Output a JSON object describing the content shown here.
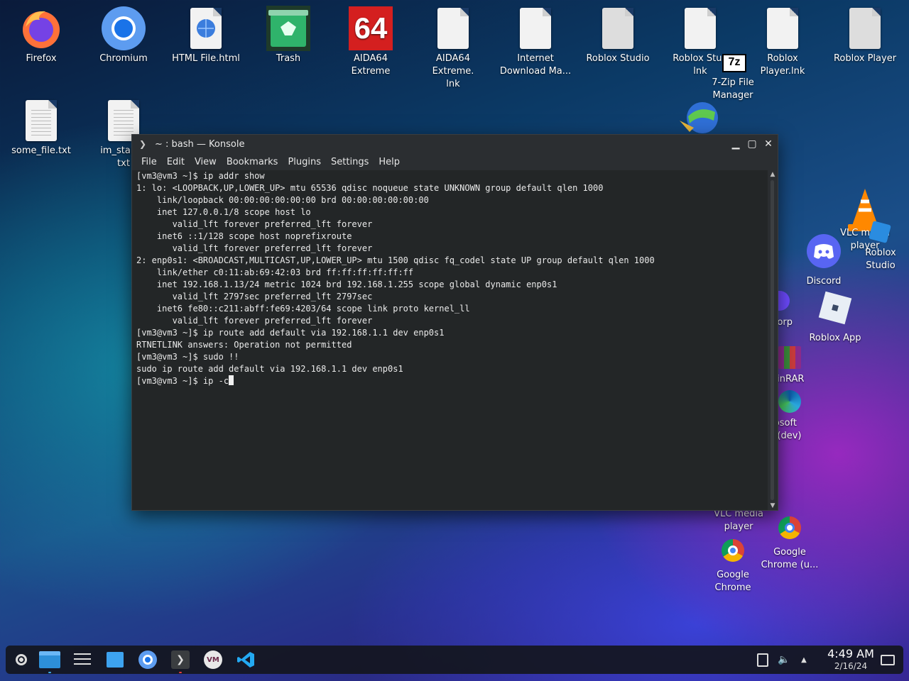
{
  "desktop": {
    "icons": {
      "firefox": "Firefox",
      "chromium": "Chromium",
      "html_file": "HTML File.html",
      "trash": "Trash",
      "aida64": "AIDA64 Extreme",
      "aida64_lnk": "AIDA64 Extreme.\nlnk",
      "idm": "Internet\nDownload Ma...",
      "roblox_studio": "Roblox Studio",
      "roblox_studio_lnk": "Roblox Stud\nlnk",
      "roblox_player_lnk": "Roblox Player.lnk",
      "roblox_player": "Roblox Player",
      "sevenzip": "7-Zip File\nManager",
      "some_file": "some_file.txt",
      "im_stalkin": "im_stalkin\ntxt",
      "vlc_top": "VLC media\nplayer",
      "roblox_studio_right": "Roblox\nStudio",
      "discord": "Discord",
      "orp": "orp",
      "roblox_app": "Roblox App",
      "winrar": "VinRAR",
      "edge_dev": "icrosoft\nge (dev)",
      "vlc_bottom": "VLC media\nplayer",
      "chrome_unstable": "Google\nChrome (u...",
      "chrome": "Google\nChrome"
    },
    "aida_badge": "64",
    "sevenzip_badge": "7z"
  },
  "konsole": {
    "title": "~ : bash — Konsole",
    "menu": [
      "File",
      "Edit",
      "View",
      "Bookmarks",
      "Plugins",
      "Settings",
      "Help"
    ],
    "lines": [
      "[vm3@vm3 ~]$ ip addr show",
      "1: lo: <LOOPBACK,UP,LOWER_UP> mtu 65536 qdisc noqueue state UNKNOWN group default qlen 1000",
      "    link/loopback 00:00:00:00:00:00 brd 00:00:00:00:00:00",
      "    inet 127.0.0.1/8 scope host lo",
      "       valid_lft forever preferred_lft forever",
      "    inet6 ::1/128 scope host noprefixroute",
      "       valid_lft forever preferred_lft forever",
      "2: enp0s1: <BROADCAST,MULTICAST,UP,LOWER_UP> mtu 1500 qdisc fq_codel state UP group default qlen 1000",
      "    link/ether c0:11:ab:69:42:03 brd ff:ff:ff:ff:ff:ff",
      "    inet 192.168.1.13/24 metric 1024 brd 192.168.1.255 scope global dynamic enp0s1",
      "       valid_lft 2797sec preferred_lft 2797sec",
      "    inet6 fe80::c211:abff:fe69:4203/64 scope link proto kernel_ll",
      "       valid_lft forever preferred_lft forever",
      "[vm3@vm3 ~]$ ip route add default via 192.168.1.1 dev enp0s1",
      "RTNETLINK answers: Operation not permitted",
      "[vm3@vm3 ~]$ sudo !!",
      "sudo ip route add default via 192.168.1.1 dev enp0s1"
    ],
    "current_prompt": "[vm3@vm3 ~]$ ip -c"
  },
  "taskbar": {
    "apps": [
      "app-launcher",
      "file-manager",
      "system-settings",
      "discover-store",
      "chromium",
      "konsole",
      "virt-manager",
      "vscode"
    ],
    "clock_time": "4:49 AM",
    "clock_date": "2/16/24"
  },
  "colors": {
    "terminal_bg": "#232627",
    "titlebar": "#2b2e31",
    "accent": "#3daee9"
  }
}
